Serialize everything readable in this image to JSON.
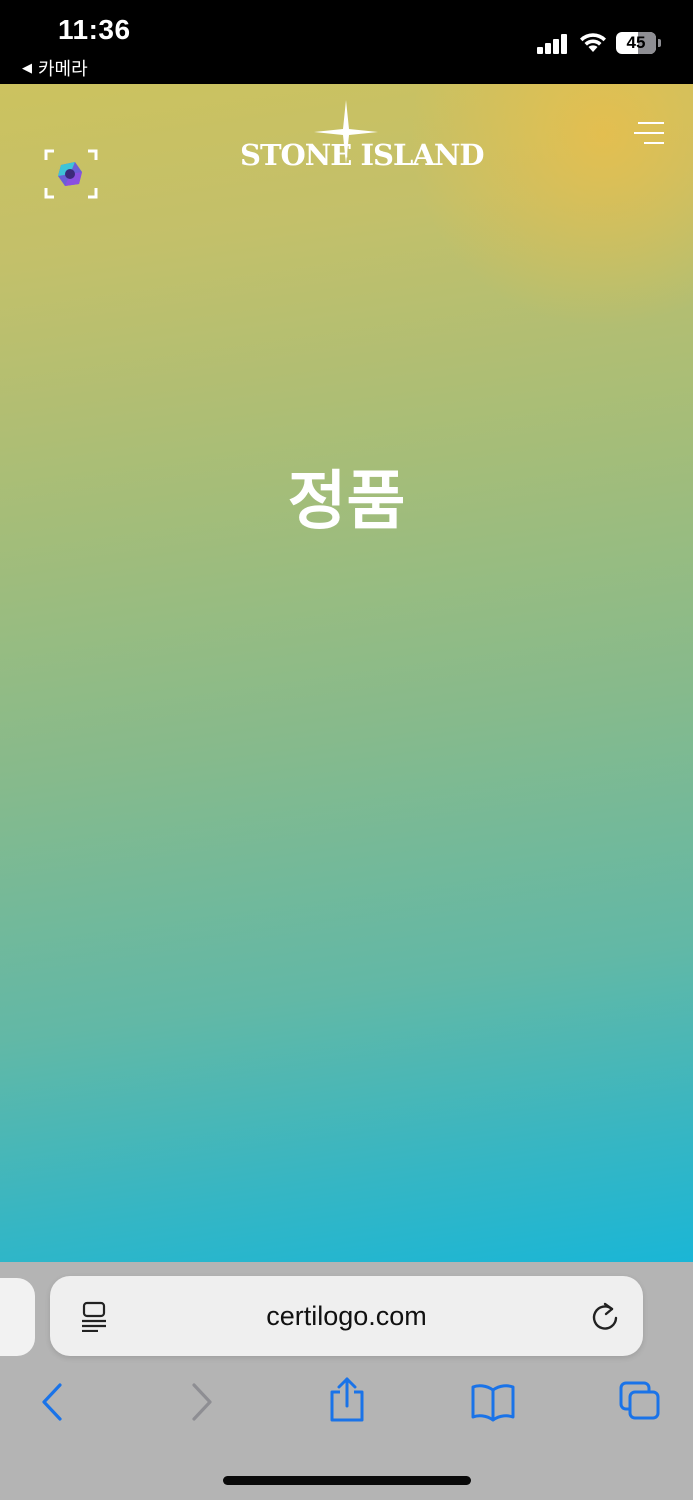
{
  "status_bar": {
    "time": "11:36",
    "back_app_label": "카메라",
    "battery_level": "45"
  },
  "page": {
    "logo_text": "STONE ISLAND",
    "headline": "정품",
    "colors": {
      "gradient_top": "#ccc25f",
      "gradient_bottom": "#1ab6d6"
    }
  },
  "safari": {
    "url": "certilogo.com",
    "toolbar": [
      "back-icon",
      "forward-icon",
      "share-icon",
      "bookmarks-icon",
      "tabs-icon"
    ],
    "accent": "#1a73e8"
  }
}
